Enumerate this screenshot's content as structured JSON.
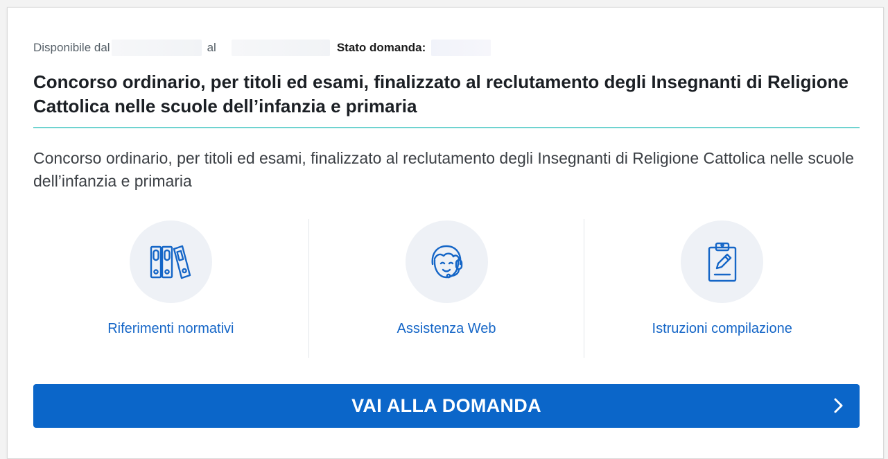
{
  "meta": {
    "available_from_label": "Disponibile dal",
    "to_label": "al",
    "status_label": "Stato domanda:"
  },
  "title": "Concorso ordinario, per titoli ed esami, finalizzato al reclutamento degli Insegnanti di Religione Cattolica nelle scuole dell’infanzia e primaria",
  "description": "Concorso ordinario, per titoli ed esami, finalizzato al reclutamento degli Insegnanti di Religione Cattolica nelle scuole dell’infanzia e primaria",
  "links": [
    {
      "label": "Riferimenti normativi",
      "icon": "binders-icon"
    },
    {
      "label": "Assistenza Web",
      "icon": "support-headset-icon"
    },
    {
      "label": "Istruzioni compilazione",
      "icon": "clipboard-edit-icon"
    }
  ],
  "cta": {
    "label": "VAI ALLA DOMANDA",
    "icon": "chevron-right-icon"
  },
  "colors": {
    "primary": "#0b66c9",
    "link": "#1566c7",
    "divider": "#6fd3d0",
    "icon_circle": "#eef1f6"
  }
}
